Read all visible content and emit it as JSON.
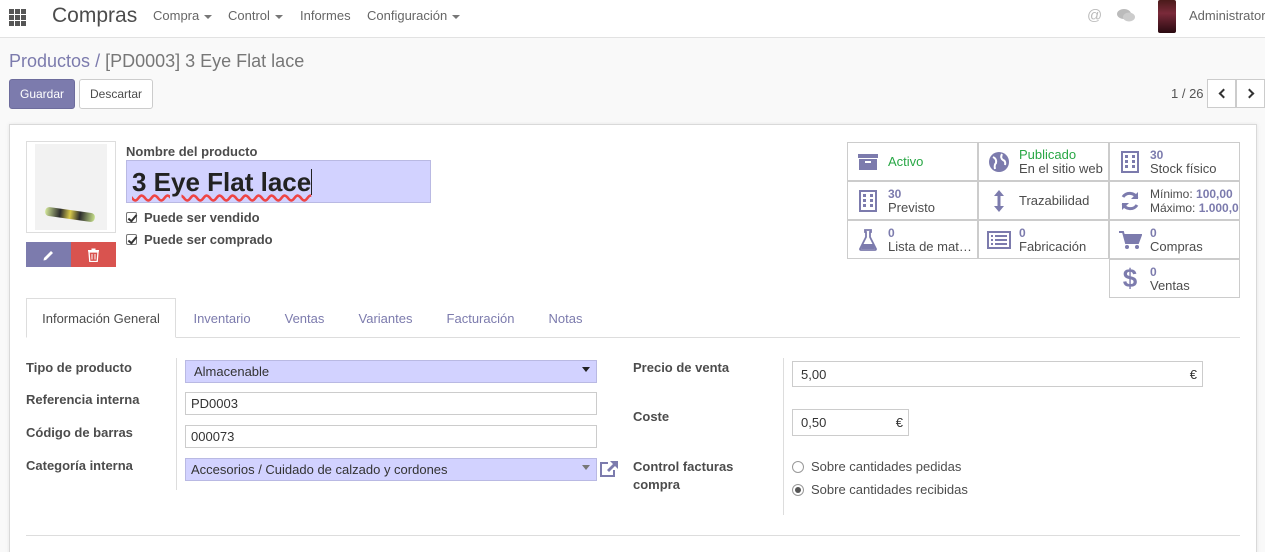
{
  "topbar": {
    "app_title": "Compras",
    "menu": [
      "Compra",
      "Control",
      "Informes",
      "Configuración"
    ],
    "user": "Administrator"
  },
  "breadcrumb": {
    "parent": "Productos",
    "separator": "/",
    "current": "[PD0003] 3 Eye Flat lace"
  },
  "actions": {
    "save": "Guardar",
    "discard": "Descartar"
  },
  "pager": {
    "value": "1 / 26"
  },
  "product": {
    "name_label": "Nombre del producto",
    "name": "3 Eye Flat lace",
    "can_be_sold": "Puede ser vendido",
    "can_be_purchased": "Puede ser comprado"
  },
  "smart_buttons": {
    "active": "Activo",
    "published_1": "Publicado",
    "published_2": "En el sitio web",
    "stock_num": "30",
    "stock_label": "Stock físico",
    "forecast_num": "30",
    "forecast_label": "Previsto",
    "traceability": "Trazabilidad",
    "min_label": "Mínimo:",
    "min_value": "100,00",
    "max_label": "Máximo:",
    "max_value": "1.000,00",
    "bom_num": "0",
    "bom_label": "Lista de mat…",
    "mfg_num": "0",
    "mfg_label": "Fabricación",
    "purchases_num": "0",
    "purchases_label": "Compras",
    "sales_num": "0",
    "sales_label": "Ventas"
  },
  "tabs": [
    "Información General",
    "Inventario",
    "Ventas",
    "Variantes",
    "Facturación",
    "Notas"
  ],
  "form": {
    "product_type_label": "Tipo de producto",
    "product_type": "Almacenable",
    "internal_ref_label": "Referencia interna",
    "internal_ref": "PD0003",
    "barcode_label": "Código de barras",
    "barcode": "000073",
    "category_label": "Categoría interna",
    "category": "Accesorios / Cuidado de calzado y cordones",
    "sale_price_label": "Precio de venta",
    "sale_price": "5,00",
    "cost_label": "Coste",
    "cost": "0,50",
    "currency": "€",
    "invoice_control_label_1": "Control facturas",
    "invoice_control_label_2": "compra",
    "invoice_option_1": "Sobre cantidades pedidas",
    "invoice_option_2": "Sobre cantidades recibidas"
  },
  "icons": {
    "apps": "apps-grid-icon",
    "mention": "at-icon",
    "chat": "chat-icon",
    "edit": "pencil-icon",
    "delete": "trash-icon",
    "external": "external-link-icon"
  },
  "colors": {
    "primary": "#7c7bad",
    "danger": "#d9534f",
    "required_field": "#d2d2ff",
    "success": "#28a745"
  }
}
